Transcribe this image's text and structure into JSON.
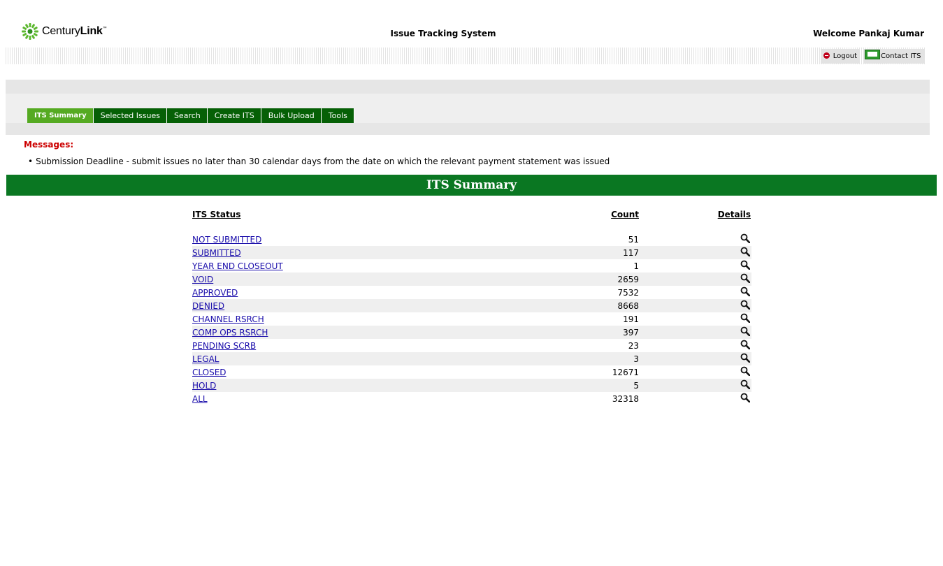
{
  "header": {
    "logo": {
      "brand_regular": "Century",
      "brand_bold": "Link",
      "tm": "™"
    },
    "app_title": "Issue Tracking System",
    "welcome": "Welcome Pankaj Kumar",
    "logout_label": "Logout",
    "contact_label": "Contact ITS"
  },
  "nav": {
    "tabs": [
      {
        "label": "ITS Summary",
        "active": true
      },
      {
        "label": "Selected Issues",
        "active": false
      },
      {
        "label": "Search",
        "active": false
      },
      {
        "label": "Create ITS",
        "active": false
      },
      {
        "label": "Bulk Upload",
        "active": false
      },
      {
        "label": "Tools",
        "active": false
      }
    ]
  },
  "messages": {
    "label": "Messages:",
    "items": [
      "Submission Deadline - submit issues no later than 30 calendar days from the date on which the relevant payment statement was issued"
    ]
  },
  "summary": {
    "title": "ITS Summary",
    "columns": {
      "status": "ITS Status",
      "count": "Count",
      "details": "Details"
    },
    "rows": [
      {
        "status": "NOT SUBMITTED",
        "count": "51"
      },
      {
        "status": "SUBMITTED",
        "count": "117"
      },
      {
        "status": "YEAR END CLOSEOUT",
        "count": "1"
      },
      {
        "status": "VOID",
        "count": "2659"
      },
      {
        "status": "APPROVED",
        "count": "7532"
      },
      {
        "status": "DENIED",
        "count": "8668"
      },
      {
        "status": "CHANNEL RSRCH",
        "count": "191"
      },
      {
        "status": "COMP OPS RSRCH",
        "count": "397"
      },
      {
        "status": "PENDING SCRB",
        "count": "23"
      },
      {
        "status": "LEGAL",
        "count": "3"
      },
      {
        "status": "CLOSED",
        "count": "12671"
      },
      {
        "status": "HOLD",
        "count": "5"
      },
      {
        "status": "ALL",
        "count": "32318"
      }
    ]
  },
  "colors": {
    "nav_tab": "#066006",
    "nav_tab_active": "#55aa22",
    "summary_bar": "#0a7722",
    "message_label": "#cc0000",
    "link": "#1a0dab"
  },
  "icons": {
    "logo": "centurylink-logo-icon",
    "logout": "stop-icon",
    "contact": "mail-icon",
    "details": "magnifier-icon"
  }
}
